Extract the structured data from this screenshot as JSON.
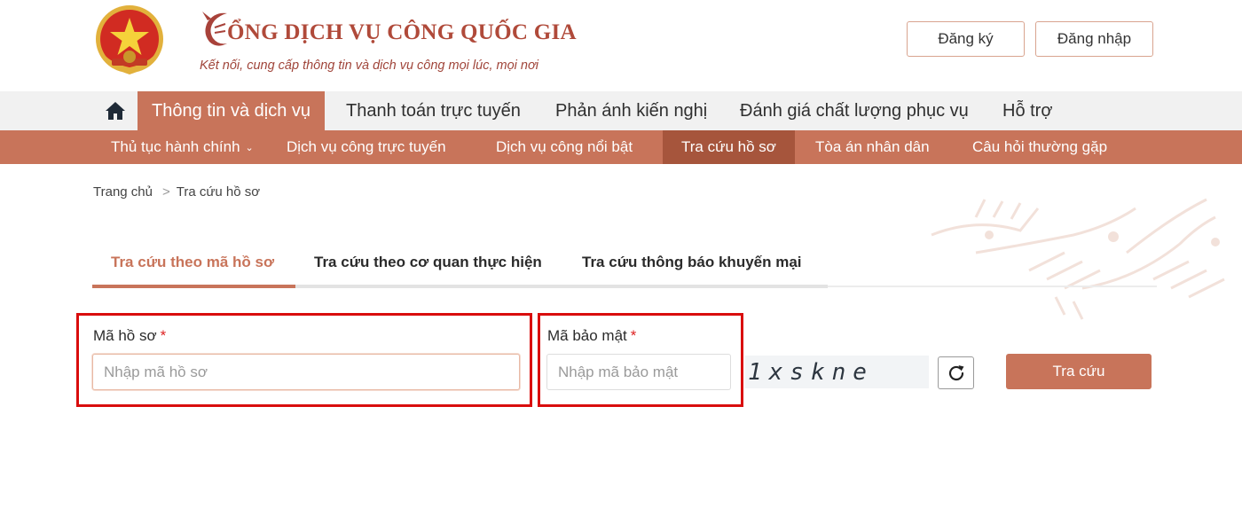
{
  "header": {
    "site_title": "CỔNG DỊCH VỤ CÔNG QUỐC GIA",
    "title_first_letter": "C",
    "title_rest": "ỔNG DỊCH VỤ CÔNG QUỐC GIA",
    "tagline": "Kết nối, cung cấp thông tin và dịch vụ công mọi lúc, mọi nơi",
    "register_label": "Đăng ký",
    "login_label": "Đăng nhập"
  },
  "main_nav": {
    "items": [
      {
        "label": "Thông tin và dịch vụ",
        "active": true
      },
      {
        "label": "Thanh toán trực tuyến"
      },
      {
        "label": "Phản ánh kiến nghị"
      },
      {
        "label": "Đánh giá chất lượng phục vụ"
      },
      {
        "label": "Hỗ trợ"
      }
    ]
  },
  "sub_nav": {
    "items": [
      {
        "label": "Thủ tục hành chính"
      },
      {
        "label": "Dịch vụ công trực tuyến"
      },
      {
        "label": "Dịch vụ công nổi bật"
      },
      {
        "label": "Tra cứu hồ sơ",
        "active": true
      },
      {
        "label": "Tòa án nhân dân"
      },
      {
        "label": "Câu hỏi thường gặp"
      }
    ]
  },
  "breadcrumb": {
    "home": "Trang chủ",
    "separator": ">",
    "current": "Tra cứu hồ sơ"
  },
  "tabs": [
    {
      "label": "Tra cứu theo mã hồ sơ",
      "active": true
    },
    {
      "label": "Tra cứu theo cơ quan thực hiện"
    },
    {
      "label": "Tra cứu thông báo khuyến mại"
    }
  ],
  "form": {
    "ma_ho_so_label": "Mã hồ sơ",
    "ma_ho_so_placeholder": "Nhập mã hồ sơ",
    "ma_bao_mat_label": "Mã bảo mật",
    "ma_bao_mat_placeholder": "Nhập mã bảo mật",
    "required_mark": "*",
    "captcha_text": "1xskne",
    "search_button": "Tra cứu"
  },
  "colors": {
    "accent": "#c8745a",
    "accent_dark": "#a6553c",
    "highlight_border": "#d90d0d",
    "brand_red": "#b04a3a"
  },
  "icons": {
    "home": "home-icon",
    "refresh": "refresh-icon",
    "emblem": "national-emblem-icon",
    "chevron": "chevron-down-icon"
  }
}
